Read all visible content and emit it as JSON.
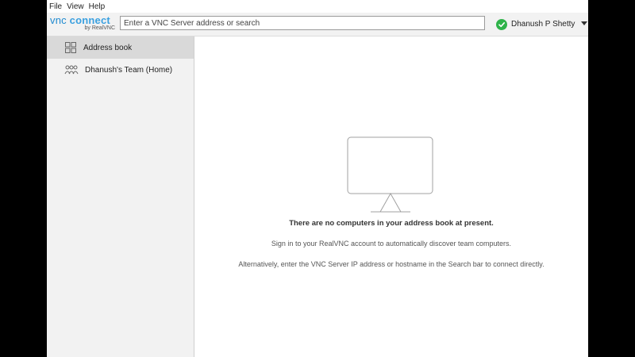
{
  "menu": {
    "file": "File",
    "view": "View",
    "help": "Help"
  },
  "logo": {
    "vnc": "vnc",
    "connect": "connect",
    "sub": "by RealVNC"
  },
  "search": {
    "placeholder": "Enter a VNC Server address or search",
    "value": ""
  },
  "user": {
    "name": "Dhanush P Shetty",
    "status_color": "#2fb34a"
  },
  "sidebar": {
    "items": [
      {
        "label": "Address book",
        "icon": "grid-icon",
        "selected": true
      },
      {
        "label": "Dhanush's Team (Home)",
        "icon": "team-icon",
        "selected": false
      }
    ]
  },
  "main": {
    "empty_title": "There are no computers in your address book at present.",
    "line1": "Sign in to your RealVNC account to automatically discover team computers.",
    "line2": "Alternatively, enter the VNC Server IP address or hostname in the Search bar to connect directly."
  }
}
